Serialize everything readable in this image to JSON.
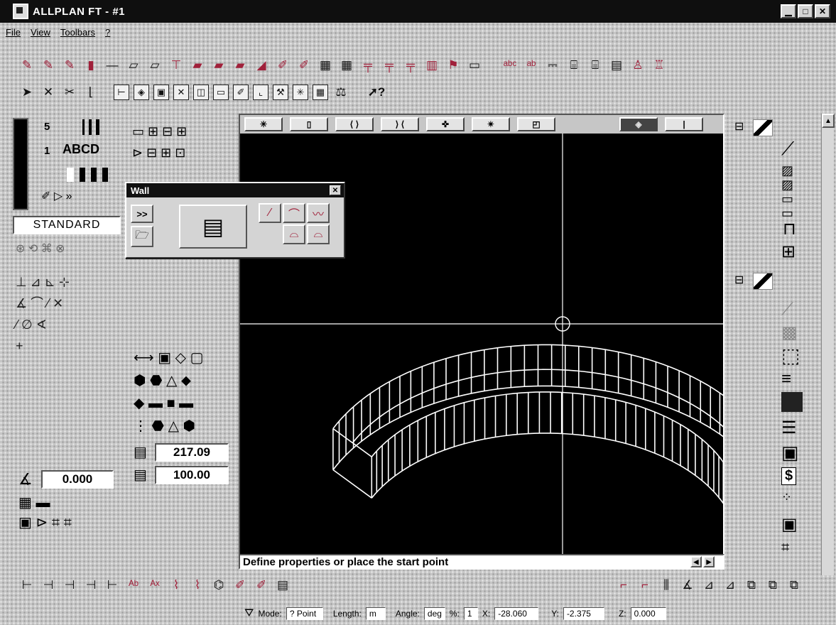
{
  "window": {
    "title": "ALLPLAN FT - #1",
    "minimize": "▁",
    "maximize": "□",
    "close": "✕"
  },
  "menu": {
    "file": "File",
    "view": "View",
    "toolbars": "Toolbars",
    "help": "?"
  },
  "pen_panel": {
    "pen_number": "5",
    "line_number": "1",
    "text_style": "ABCD",
    "standard_label": "STANDARD"
  },
  "angle_field": {
    "value": "0.000"
  },
  "dimension_fields": {
    "length": "217.09",
    "scale": "100.00"
  },
  "wall_dialog": {
    "title": "Wall",
    "close": "✕",
    "expand": ">>"
  },
  "prompt": {
    "text": "Define properties or place the start point"
  },
  "status": {
    "mode_label": "Mode:",
    "mode_value": "? Point",
    "length_label": "Length:",
    "length_unit": "m",
    "angle_label": "Angle:",
    "angle_unit": "deg",
    "percent_label": "%:",
    "percent_value": "1",
    "x_label": "X:",
    "x_value": "-28.060",
    "y_label": "Y:",
    "y_value": "-2.375",
    "z_label": "Z:",
    "z_value": "0.000"
  },
  "colors": {
    "title_bg": "#0f0f0f",
    "viewport_bg": "#000000",
    "wire": "#ffffff",
    "tool_accent": "#a0203a"
  }
}
